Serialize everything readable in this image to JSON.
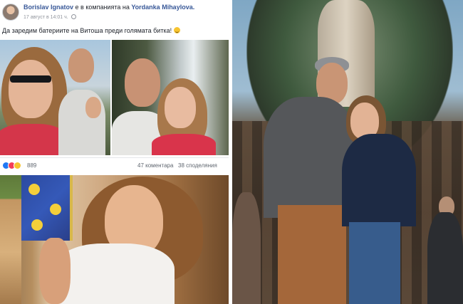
{
  "post": {
    "author": "Borislav Ignatov",
    "companion_prefix": "е в компанията на",
    "companion": "Yordanka Mihaylova.",
    "timestamp": "17 август в 14:01 ч.",
    "text": "Да заредим батериите на Витоша преди голямата битка!",
    "reactions": {
      "icons": [
        "like-icon",
        "love-icon",
        "wow-icon"
      ],
      "count": "889",
      "comments": "47 коментара",
      "shares": "38 споделяния"
    }
  },
  "colors": {
    "fb_blue": "#385898",
    "like_blue": "#2078f4",
    "love_red": "#f33e58",
    "wow_yellow": "#f7c42f"
  }
}
